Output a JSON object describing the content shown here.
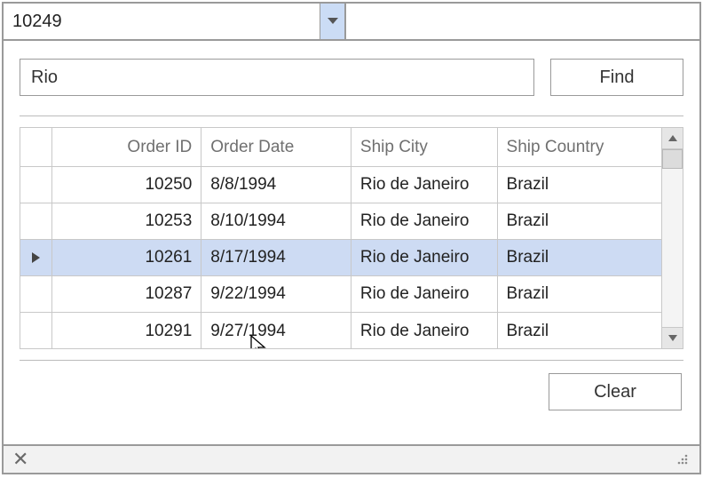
{
  "combo": {
    "value": "10249"
  },
  "search": {
    "value": "Rio"
  },
  "buttons": {
    "find": "Find",
    "clear": "Clear"
  },
  "grid": {
    "headers": {
      "order_id": "Order ID",
      "order_date": "Order Date",
      "ship_city": "Ship City",
      "ship_country": "Ship Country"
    },
    "rows": [
      {
        "order_id": "10250",
        "order_date": "8/8/1994",
        "ship_city": "Rio de Janeiro",
        "ship_country": "Brazil",
        "selected": false
      },
      {
        "order_id": "10253",
        "order_date": "8/10/1994",
        "ship_city": "Rio de Janeiro",
        "ship_country": "Brazil",
        "selected": false
      },
      {
        "order_id": "10261",
        "order_date": "8/17/1994",
        "ship_city": "Rio de Janeiro",
        "ship_country": "Brazil",
        "selected": true
      },
      {
        "order_id": "10287",
        "order_date": "9/22/1994",
        "ship_city": "Rio de Janeiro",
        "ship_country": "Brazil",
        "selected": false
      },
      {
        "order_id": "10291",
        "order_date": "9/27/1994",
        "ship_city": "Rio de Janeiro",
        "ship_country": "Brazil",
        "selected": false
      }
    ]
  }
}
